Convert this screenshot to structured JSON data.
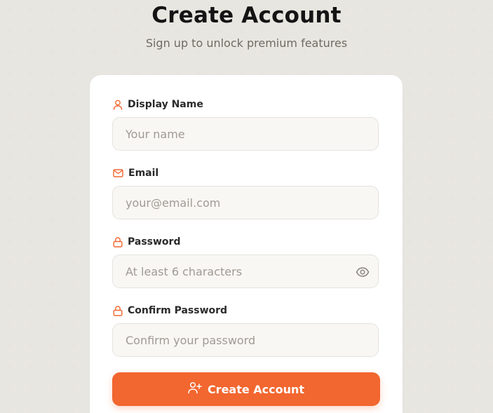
{
  "header": {
    "title": "Create Account",
    "subtitle": "Sign up to unlock premium features"
  },
  "form": {
    "display_name": {
      "label": "Display Name",
      "icon": "user-icon",
      "placeholder": "Your name",
      "value": ""
    },
    "email": {
      "label": "Email",
      "icon": "mail-icon",
      "placeholder": "your@email.com",
      "value": ""
    },
    "password": {
      "label": "Password",
      "icon": "lock-icon",
      "placeholder": "At least 6 characters",
      "value": "",
      "toggle_icon": "eye-icon"
    },
    "confirm_password": {
      "label": "Confirm Password",
      "icon": "lock-icon",
      "placeholder": "Confirm your password",
      "value": ""
    },
    "submit": {
      "label": "Create Account",
      "icon": "user-plus-icon"
    }
  },
  "colors": {
    "accent": "#f2662f",
    "background": "#f8f7f4",
    "card": "#ffffff",
    "input_bg": "#f8f7f4",
    "input_border": "#e6e3de",
    "title": "#141414",
    "subtitle": "#6f6a63",
    "placeholder": "#a09a93"
  }
}
